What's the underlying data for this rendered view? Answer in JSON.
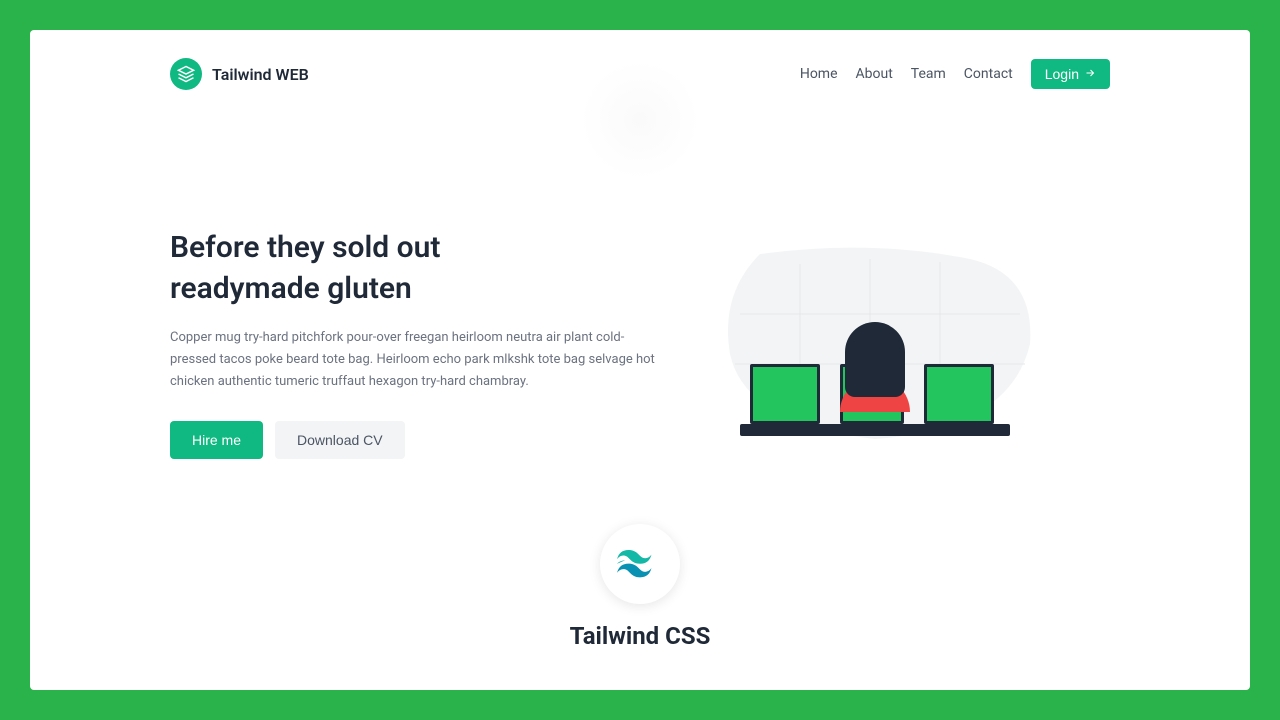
{
  "brand": {
    "name": "Tailwind WEB"
  },
  "nav": {
    "home": "Home",
    "about": "About",
    "team": "Team",
    "contact": "Contact",
    "login": "Login"
  },
  "hero": {
    "title_line1": "Before they sold out",
    "title_line2": "readymade gluten",
    "description": "Copper mug try-hard pitchfork pour-over freegan heirloom neutra air plant cold-pressed tacos poke beard tote bag. Heirloom echo park mlkshk tote bag selvage hot chicken authentic tumeric truffaut hexagon try-hard chambray.",
    "btn_primary": "Hire me",
    "btn_secondary": "Download CV"
  },
  "footer": {
    "title": "Tailwind CSS"
  }
}
